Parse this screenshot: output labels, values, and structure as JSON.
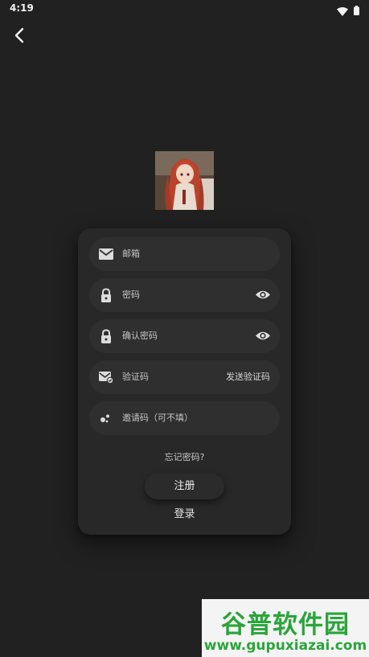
{
  "status_bar": {
    "time": "4:19"
  },
  "form": {
    "email_label": "邮箱",
    "password_label": "密码",
    "confirm_password_label": "确认密码",
    "code_label": "验证码",
    "send_code_label": "发送验证码",
    "invite_label": "邀请码（可不填）",
    "forgot_label": "忘记密码?",
    "register_label": "注册",
    "login_label": "登录"
  },
  "watermark": {
    "title": "谷普软件园",
    "url": "www.gupuxiazai.com"
  }
}
